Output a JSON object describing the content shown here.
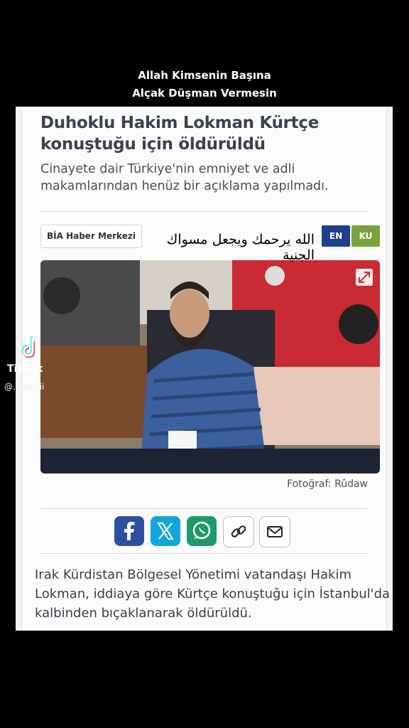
{
  "caption": {
    "line1": "Allah Kimsenin Başına",
    "line2": "Alçak Düşman Vermesin"
  },
  "article": {
    "headline": "Duhoklu Hakim Lokman Kürtçe konuştuğu için öldürüldü",
    "subhead": "Cinayete dair Türkiye'nin emniyet ve adli makamlarından henüz bir açıklama yapılmadı.",
    "source": "BİA Haber Merkezi",
    "overlay_text": "الله يرحمك ويجعل مسواك الجنية",
    "lang_en": "EN",
    "lang_ku": "KU",
    "photo_credit": "Fotoğraf: Rûdaw",
    "body": "Irak Kürdistan Bölgesel Yönetimi vatandaşı Hakim Lokman, iddiaya göre Kürtçe konuştuğu için İstanbul'da kalbinden bıçaklanarak öldürüldü."
  },
  "share": {
    "facebook_color": "#2d4f9e",
    "x_color": "#16a4dd",
    "whatsapp_color": "#1f9a6a",
    "icons": [
      "facebook-icon",
      "x-icon",
      "whatsapp-icon",
      "link-icon",
      "mail-icon"
    ]
  },
  "tiktok": {
    "logo_text": "TikTok",
    "username": "@...atchii"
  }
}
